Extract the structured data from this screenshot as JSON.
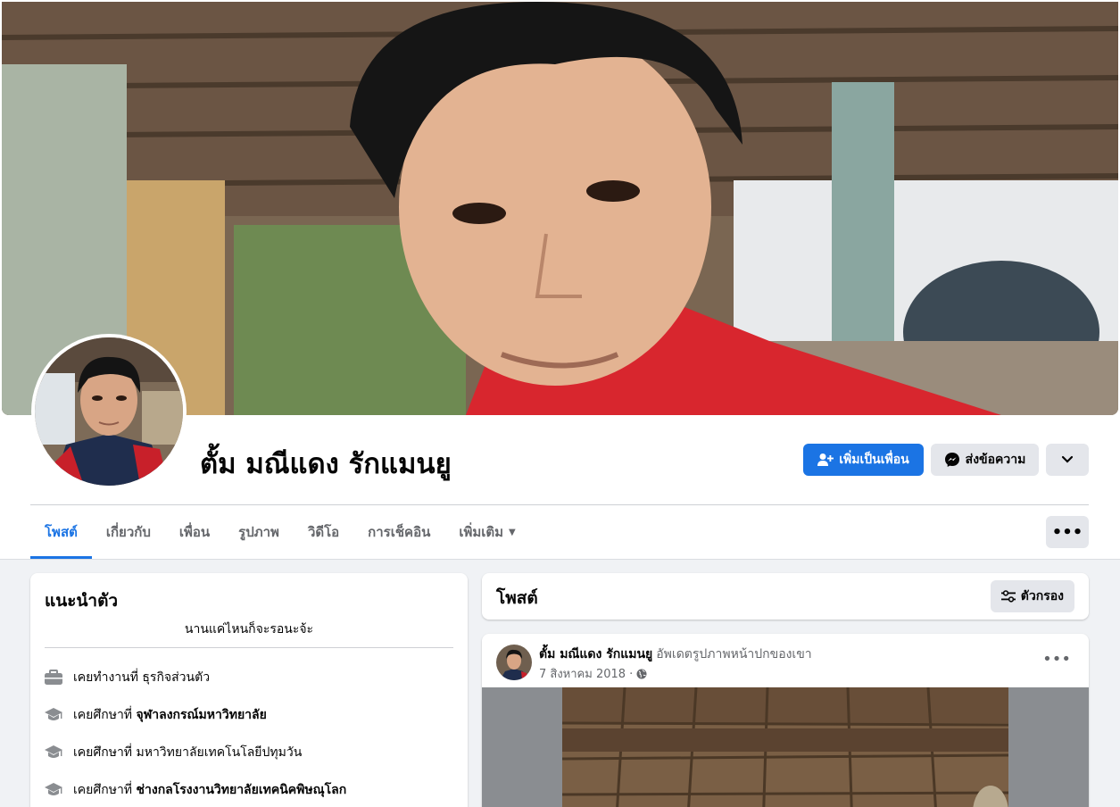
{
  "profile": {
    "name": "ตั้ม มณีแดง รักแมนยู",
    "add_friend_label": "เพิ่มเป็นเพื่อน",
    "message_label": "ส่งข้อความ"
  },
  "tabs": [
    {
      "label": "โพสต์",
      "active": true
    },
    {
      "label": "เกี่ยวกับ"
    },
    {
      "label": "เพื่อน"
    },
    {
      "label": "รูปภาพ"
    },
    {
      "label": "วิดีโอ"
    },
    {
      "label": "การเช็คอิน"
    },
    {
      "label": "เพิ่มเติม"
    }
  ],
  "intro": {
    "title": "แนะนำตัว",
    "bio": "นานแค่ไหนก็จะรอนะจ้ะ",
    "items": [
      {
        "icon": "briefcase-icon",
        "prefix": "เคยทำงานที่ ธุรกิจส่วนตัว",
        "bold": ""
      },
      {
        "icon": "graduation-cap-icon",
        "prefix": "เคยศึกษาที่",
        "bold": "จุฬาลงกรณ์มหาวิทยาลัย"
      },
      {
        "icon": "graduation-cap-icon",
        "prefix": "เคยศึกษาที่ มหาวิทยาลัยเทคโนโลยีปทุมวัน",
        "bold": ""
      },
      {
        "icon": "graduation-cap-icon",
        "prefix": "เคยศึกษาที่",
        "bold": "ช่างกลโรงงานวิทยาลัยเทคนิคพิษณุโลก"
      }
    ]
  },
  "posts": {
    "title": "โพสต์",
    "filter_label": "ตัวกรอง",
    "post": {
      "author": "ตั้ม มณีแดง รักแมนยู",
      "action": "อัพเดตรูปภาพหน้าปกของเขา",
      "date": "7 สิงหาคม 2018 ·"
    }
  },
  "colors": {
    "accent": "#1b74e4",
    "secondary_button": "#e4e6eb",
    "page_background": "#f0f2f5"
  }
}
